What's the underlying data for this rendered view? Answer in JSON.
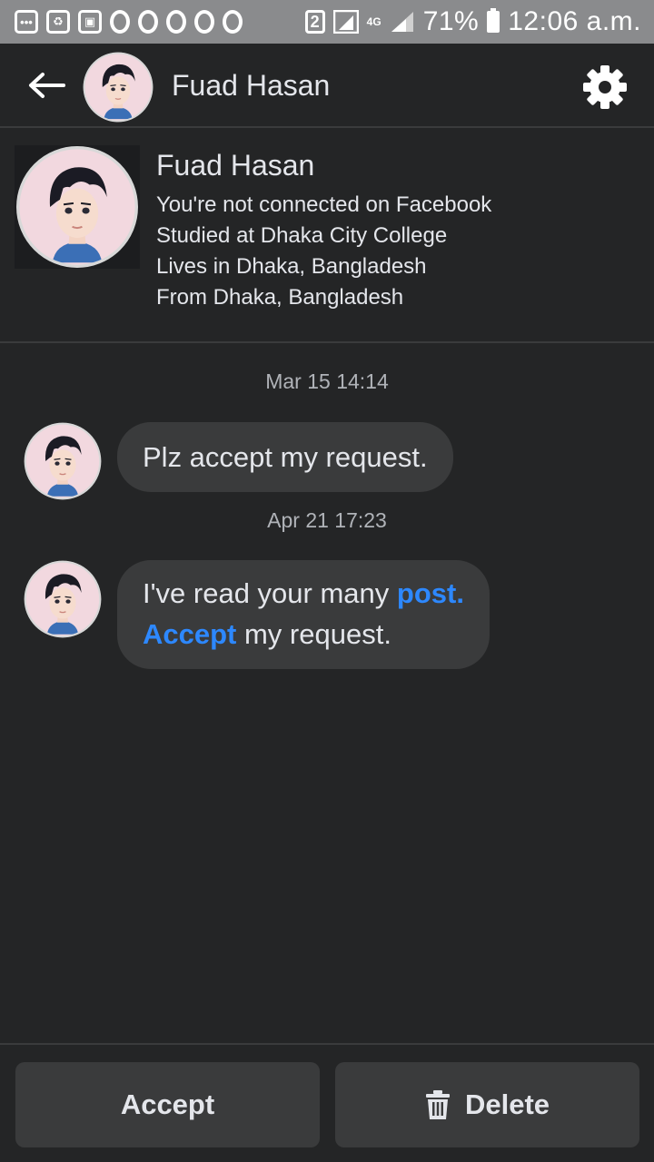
{
  "status_bar": {
    "sim_number": "2",
    "network": "4G",
    "battery": "71%",
    "time": "12:06 a.m."
  },
  "header": {
    "title": "Fuad Hasan",
    "back_icon": "arrow-left-icon",
    "settings_icon": "gear-icon"
  },
  "profile": {
    "name": "Fuad Hasan",
    "lines": [
      "You're not connected on Facebook",
      "Studied at Dhaka City College",
      "Lives in Dhaka, Bangladesh",
      "From Dhaka, Bangladesh"
    ]
  },
  "messages": [
    {
      "timestamp": "Mar 15 14:14",
      "text": "Plz accept my request."
    },
    {
      "timestamp": "Apr 21 17:23",
      "line1_prefix": "I've read your many ",
      "line1_link": "post.",
      "line2_link": "Accept",
      "line2_suffix": " my request."
    }
  ],
  "actions": {
    "accept_label": "Accept",
    "delete_label": "Delete",
    "delete_icon": "trash-icon"
  },
  "colors": {
    "background": "#242526",
    "bubble": "#3a3b3c",
    "link": "#2d88ff",
    "status_bar": "#8a8b8d"
  }
}
